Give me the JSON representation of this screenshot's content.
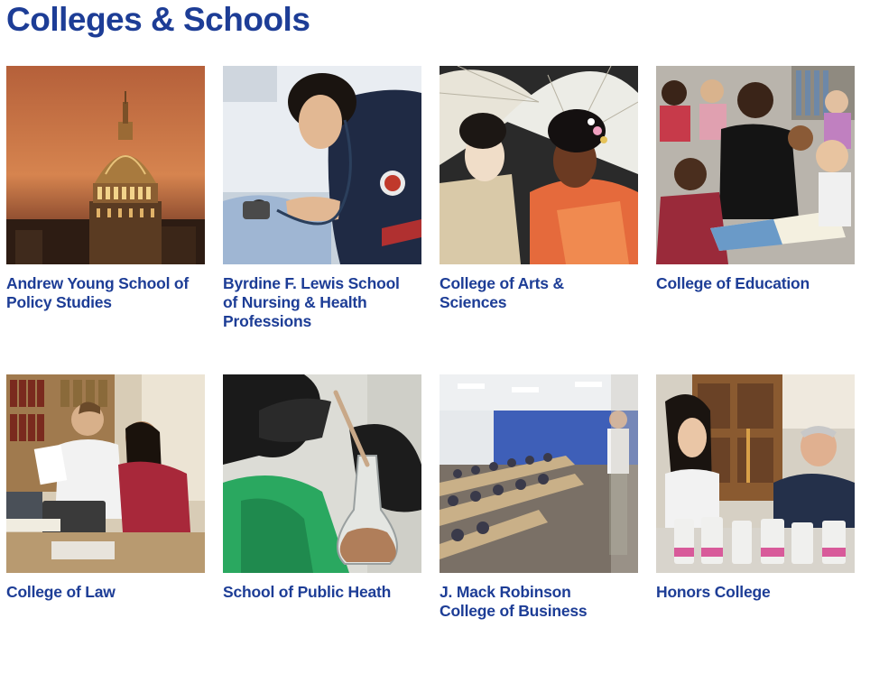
{
  "page": {
    "title": "Colleges & Schools"
  },
  "colors": {
    "heading": "#1d3d96",
    "link": "#1d3d96",
    "background": "#ffffff"
  },
  "schools": [
    {
      "label": "Andrew Young School of Policy Studies",
      "image": "capitol-dome-sunset-photo"
    },
    {
      "label": "Byrdine F. Lewis School of Nursing & Health Professions",
      "image": "nursing-student-blood-pressure-photo"
    },
    {
      "label": "College of Arts & Sciences",
      "image": "performers-with-parasols-photo"
    },
    {
      "label": "College of Education",
      "image": "teacher-reading-to-children-photo"
    },
    {
      "label": "College of Law",
      "image": "law-students-library-photo"
    },
    {
      "label": "School of Public Heath",
      "image": "gloved-hands-flask-photo"
    },
    {
      "label": "J. Mack Robinson College of Business",
      "image": "business-classroom-lecture-photo"
    },
    {
      "label": "Honors College",
      "image": "honors-lab-research-photo"
    }
  ]
}
